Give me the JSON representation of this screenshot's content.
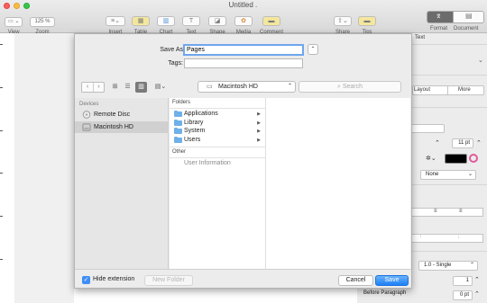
{
  "window": {
    "title": "Untitled"
  },
  "toolbar": {
    "view_label": "View",
    "zoom_value": "125 %",
    "zoom_label": "Zoom",
    "items": [
      {
        "label": "Insert"
      },
      {
        "label": "Table"
      },
      {
        "label": "Chart"
      },
      {
        "label": "Text"
      },
      {
        "label": "Shape"
      },
      {
        "label": "Media"
      },
      {
        "label": "Comment"
      },
      {
        "label": "Share"
      },
      {
        "label": "Tips"
      },
      {
        "label": "Format"
      },
      {
        "label": "Document"
      }
    ]
  },
  "dialog": {
    "save_as_label": "Save As:",
    "save_as_value": "Pages",
    "tags_label": "Tags:",
    "tags_value": "",
    "location": "Macintosh HD",
    "search_placeholder": "Search",
    "sidebar": {
      "header": "Devices",
      "items": [
        {
          "label": "Remote Disc"
        },
        {
          "label": "Macintosh HD"
        }
      ]
    },
    "column1": {
      "folders_header": "Folders",
      "folders": [
        {
          "label": "Applications"
        },
        {
          "label": "Library"
        },
        {
          "label": "System"
        },
        {
          "label": "Users"
        }
      ],
      "other_header": "Other",
      "other": [
        {
          "label": "User Information"
        }
      ]
    },
    "hide_extension_label": "Hide extension",
    "hide_extension_checked": true,
    "new_folder_label": "New Folder",
    "cancel_label": "Cancel",
    "save_label": "Save"
  },
  "inspector": {
    "text_tab": "Text",
    "layout_tab": "Layout",
    "more_tab": "More",
    "font_size": "11 pt",
    "paragraph_style": "None",
    "line_spacing": "1.0 - Single",
    "spacing_value": "1",
    "before_paragraph_label": "Before Paragraph",
    "before_paragraph_value": "0 pt",
    "colors": {
      "accent": "#1d81f6",
      "text_color": "#000000"
    }
  }
}
